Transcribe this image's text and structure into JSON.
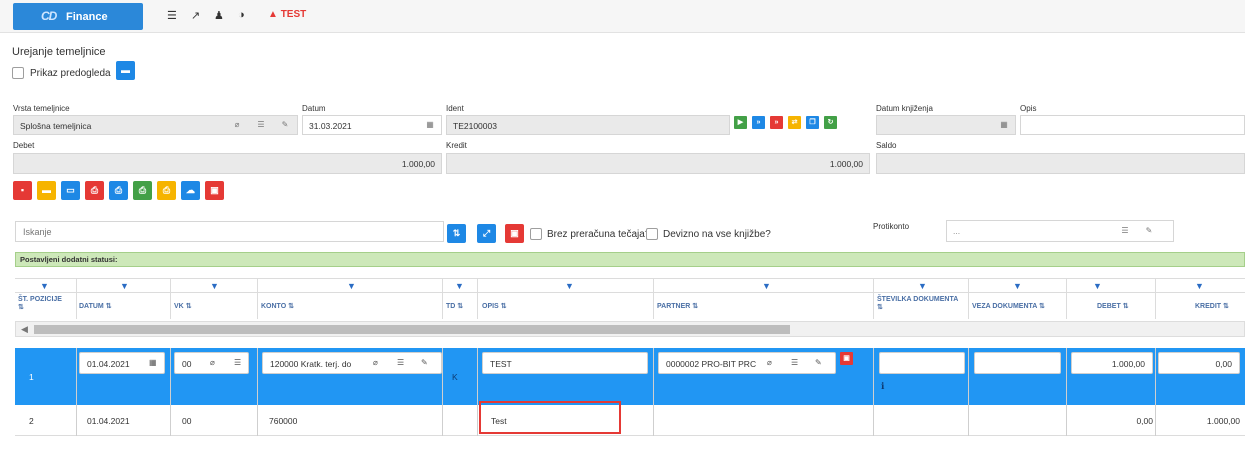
{
  "topbar": {
    "brand": "Finance",
    "brand_logo": "CD",
    "icons": [
      "list-icon",
      "external-link-icon",
      "user-icon",
      "contrast-icon"
    ],
    "test_label": "TEST"
  },
  "page": {
    "title": "Urejanje temeljnice",
    "preview_label": "Prikaz predogleda"
  },
  "form": {
    "vrsta_label": "Vrsta temeljnice",
    "vrsta_value": "Splošna temeljnica",
    "datum_label": "Datum",
    "datum_value": "31.03.2021",
    "ident_label": "Ident",
    "ident_value": "TE2100003",
    "datum_knjizenja_label": "Datum knjiženja",
    "datum_knjizenja_value": "",
    "opis_label": "Opis",
    "opis_value": "",
    "debet_label": "Debet",
    "debet_value": "1.000,00",
    "kredit_label": "Kredit",
    "kredit_value": "1.000,00",
    "saldo_label": "Saldo",
    "saldo_value": ""
  },
  "toolbar2": {
    "search_placeholder": "Iskanje",
    "brez_label": "Brez preračuna tečaja?",
    "devizno_label": "Devizno na vse knjižbe?",
    "protikonto_label": "Protikonto",
    "protikonto_value": "..."
  },
  "status_text": "Postavljeni dodatni statusi:",
  "columns": {
    "pozicije": "ŠT. POZICIJE",
    "datum": "DATUM",
    "vk": "VK",
    "konto": "KONTO",
    "td": "TD",
    "opis": "OPIS",
    "partner": "PARTNER",
    "stevilka": "ŠTEVILKA DOKUMENTA",
    "veza": "VEZA DOKUMENTA",
    "debet": "DEBET",
    "kredit": "KREDIT"
  },
  "rows": [
    {
      "pozicija": "1",
      "datum": "01.04.2021",
      "vk": "00",
      "konto": "120000 Kratk. terj. do",
      "td": "K",
      "opis": "TEST",
      "partner": "0000002 PRO-BIT PRC",
      "stevilka": "",
      "veza": "",
      "debet": "1.000,00",
      "kredit": "0,00"
    },
    {
      "pozicija": "2",
      "datum": "01.04.2021",
      "vk": "00",
      "konto": "760000",
      "td": "",
      "opis": "Test",
      "partner": "",
      "stevilka": "",
      "veza": "",
      "debet": "0,00",
      "kredit": "1.000,00"
    }
  ],
  "colors": {
    "accent": "#2196f3",
    "status_bg": "#cde8b9",
    "highlight": "#e53935"
  }
}
